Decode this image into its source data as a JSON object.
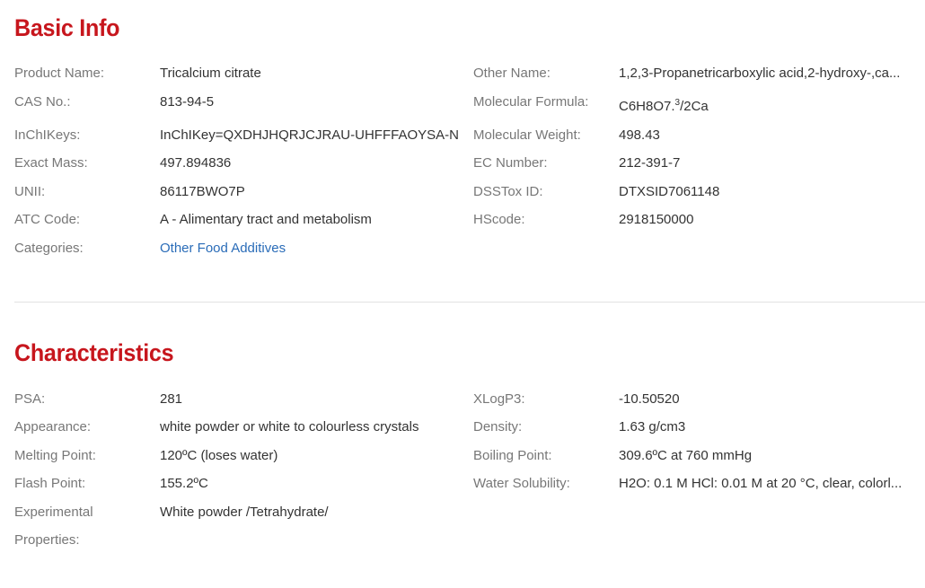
{
  "basic_info": {
    "title": "Basic Info",
    "product_name_label": "Product Name:",
    "product_name": "Tricalcium citrate",
    "other_name_label": "Other Name:",
    "other_name": "1,2,3-Propanetricarboxylic acid,2-hydroxy-,ca...",
    "cas_label": "CAS No.:",
    "cas": "813-94-5",
    "formula_label": "Molecular Formula:",
    "formula_main": "C6H8O7.",
    "formula_sup": "3",
    "formula_tail": "/2Ca",
    "inchikeys_label": "InChIKeys:",
    "inchikeys": "InChIKey=QXDHJHQRJCJRAU-UHFFFAOYSA-N",
    "mw_label": "Molecular Weight:",
    "mw": "498.43",
    "exact_mass_label": "Exact Mass:",
    "exact_mass": "497.894836",
    "ec_label": "EC Number:",
    "ec": "212-391-7",
    "unii_label": "UNII:",
    "unii": "86117BWO7P",
    "dsstox_label": "DSSTox ID:",
    "dsstox": "DTXSID7061148",
    "atc_label": "ATC Code:",
    "atc": "A - Alimentary tract and metabolism",
    "hscode_label": "HScode:",
    "hscode": "2918150000",
    "categories_label": "Categories:",
    "categories_link": "Other Food Additives",
    "link_color": "#2a6cb8"
  },
  "characteristics": {
    "title": "Characteristics",
    "psa_label": "PSA:",
    "psa": "281",
    "xlogp_label": "XLogP3:",
    "xlogp": "-10.50520",
    "appearance_label": "Appearance:",
    "appearance": "white powder or white to colourless crystals",
    "density_label": "Density:",
    "density": "1.63 g/cm3",
    "mp_label": "Melting Point:",
    "mp": "120ºC (loses water)",
    "bp_label": "Boiling Point:",
    "bp": "309.6ºC at 760 mmHg",
    "fp_label": "Flash Point:",
    "fp": "155.2ºC",
    "ws_label": "Water Solubility:",
    "ws": "H2O: 0.1 M HCl: 0.01 M at 20 °C, clear, colorl...",
    "exp_label_1": "Experimental",
    "exp_label_2": "Properties:",
    "exp": "White powder /Tetrahydrate/"
  },
  "colors": {
    "heading": "#c7161d",
    "label": "#777777",
    "value": "#333333",
    "divider": "#e2e2e2"
  }
}
